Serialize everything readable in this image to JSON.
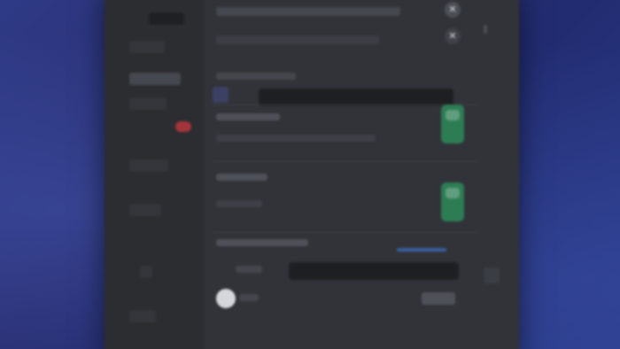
{
  "window": {
    "close_glyph": "✕",
    "settings_glyph": "✕"
  },
  "sidebar": {
    "items": [
      {
        "label": ""
      },
      {
        "label": ""
      },
      {
        "label": ""
      },
      {
        "label": ""
      },
      {
        "label": ""
      },
      {
        "label": ""
      },
      {
        "label": ""
      }
    ],
    "badge_color": "#a3343b"
  },
  "content": {
    "header": {
      "title": "",
      "subtitle": ""
    },
    "section_1": {
      "title": "",
      "input_value": ""
    },
    "section_2": {
      "title": "",
      "description": ""
    },
    "section_3": {
      "title": "",
      "description": ""
    },
    "section_4": {
      "title": "",
      "input_value": ""
    },
    "footer": {
      "button_label": ""
    }
  },
  "colors": {
    "background": "#2a2f72",
    "panel": "#313338",
    "sidebar": "#2b2d31",
    "toggle_on": "#2d7d54",
    "badge": "#a3343b"
  }
}
